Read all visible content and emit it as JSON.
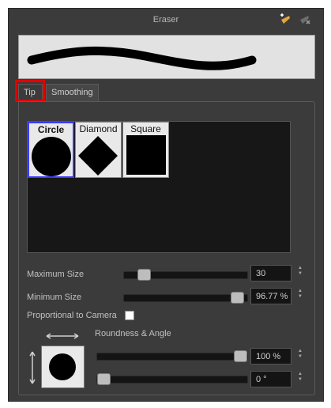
{
  "panel": {
    "title": "Eraser",
    "header_icons": [
      "add-preset-icon",
      "delete-preset-icon"
    ]
  },
  "tabs": [
    {
      "label": "Tip",
      "active": true
    },
    {
      "label": "Smoothing",
      "active": false
    }
  ],
  "tips": [
    {
      "label": "Circle",
      "shape": "circle",
      "selected": true
    },
    {
      "label": "Diamond",
      "shape": "diamond",
      "selected": false
    },
    {
      "label": "Square",
      "shape": "square",
      "selected": false
    }
  ],
  "maximum_size": {
    "label": "Maximum Size",
    "value": "30",
    "level": 0.12
  },
  "minimum_size": {
    "label": "Minimum Size",
    "value": "96.77 %",
    "level": 0.97
  },
  "proportional": {
    "label": "Proportional to Camera",
    "checked": false
  },
  "roundness_angle": {
    "label": "Roundness & Angle",
    "roundness": {
      "value": "100 %",
      "level": 1.0
    },
    "angle": {
      "value": "0 °",
      "level": 0.0
    }
  },
  "colors": {
    "accent_highlight": "#e00000",
    "selected_tip_border": "#3a3aff"
  }
}
